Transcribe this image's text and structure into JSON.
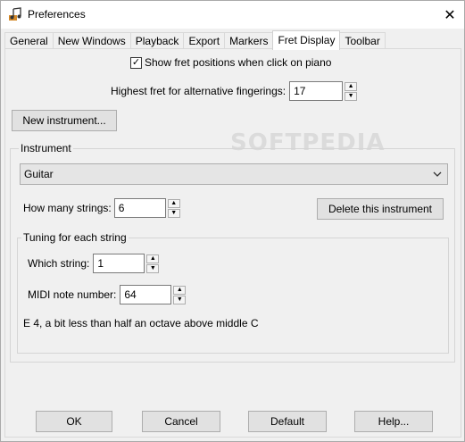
{
  "window": {
    "title": "Preferences",
    "close_glyph": "✕"
  },
  "tabs": [
    {
      "label": "General"
    },
    {
      "label": "New Windows"
    },
    {
      "label": "Playback"
    },
    {
      "label": "Export"
    },
    {
      "label": "Markers"
    },
    {
      "label": "Fret Display",
      "active": true
    },
    {
      "label": "Toolbar"
    }
  ],
  "fret_display": {
    "show_fret_positions_label": "Show fret positions when click on piano",
    "show_fret_positions_checked": true,
    "highest_fret_label": "Highest fret for alternative fingerings:",
    "highest_fret_value": "17",
    "new_instrument_button": "New instrument...",
    "instrument_group_label": "Instrument",
    "instrument_selected": "Guitar",
    "how_many_strings_label": "How many strings:",
    "how_many_strings_value": "6",
    "delete_instrument_button": "Delete this instrument",
    "tuning_group_label": "Tuning for each string",
    "which_string_label": "Which string:",
    "which_string_value": "1",
    "midi_note_label": "MIDI note number:",
    "midi_note_value": "64",
    "note_description": "E 4, a bit less than half an octave above middle C"
  },
  "footer": {
    "ok_button": "OK",
    "cancel_button": "Cancel",
    "default_button": "Default",
    "help_button": "Help..."
  },
  "watermark_text": "SOFTPEDIA",
  "icons": {
    "app": "music-notes-icon",
    "check": "✓",
    "spin_up": "▲",
    "spin_down": "▼",
    "dropdown": "chevron-down-icon"
  }
}
